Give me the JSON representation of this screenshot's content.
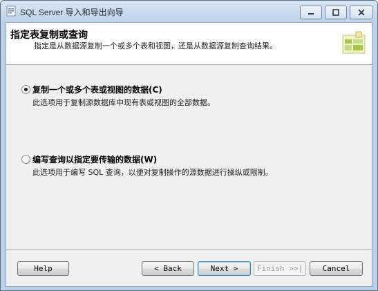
{
  "window": {
    "title": "SQL Server 导入和导出向导"
  },
  "header": {
    "title": "指定表复制或查询",
    "description": "指定是从数据源复制一个或多个表和视图，还是从数据源复制查询结果。"
  },
  "options": [
    {
      "label": "复制一个或多个表或视图的数据(C)",
      "description": "此选项用于复制源数据库中现有表或视图的全部数据。",
      "selected": true
    },
    {
      "label": "编写查询以指定要传输的数据(W)",
      "description": "此选项用于编写 SQL 查询，以便对复制操作的源数据进行操纵或限制。",
      "selected": false
    }
  ],
  "buttons": {
    "help": "Help",
    "back": "< Back",
    "next": "Next >",
    "finish": "Finish >>|",
    "cancel": "Cancel"
  }
}
